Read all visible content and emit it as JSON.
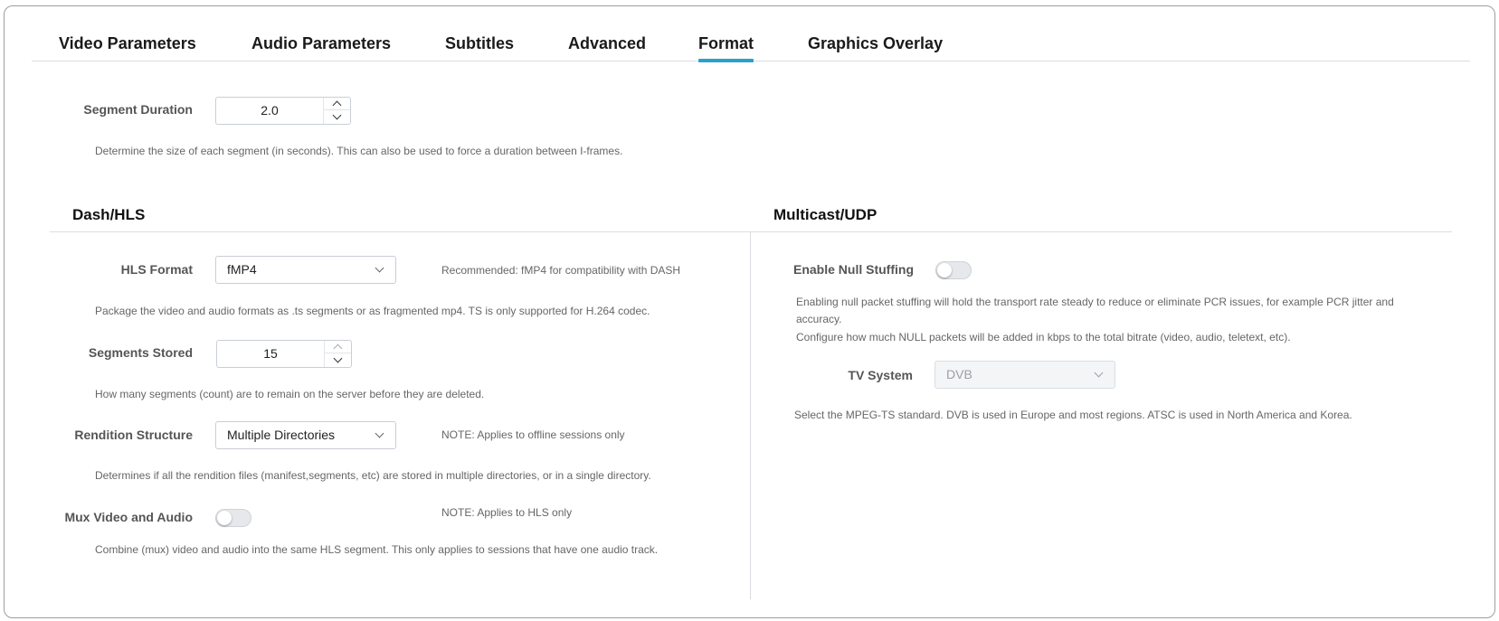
{
  "tabs": [
    {
      "label": "Video Parameters"
    },
    {
      "label": "Audio Parameters"
    },
    {
      "label": "Subtitles"
    },
    {
      "label": "Advanced"
    },
    {
      "label": "Format"
    },
    {
      "label": "Graphics Overlay"
    }
  ],
  "active_tab": "Format",
  "segment_duration": {
    "label": "Segment Duration",
    "value": "2.0",
    "help": "Determine the size of each segment (in seconds). This can also be used to force a duration between I-frames."
  },
  "dash_hls": {
    "title": "Dash/HLS",
    "hls_format": {
      "label": "HLS Format",
      "value": "fMP4",
      "note": "Recommended: fMP4 for compatibility with DASH",
      "help": "Package the video and audio formats as .ts segments or as fragmented mp4. TS is only supported for H.264 codec."
    },
    "segments_stored": {
      "label": "Segments Stored",
      "value": "15",
      "help": "How many segments (count) are to remain on the server before they are deleted."
    },
    "rendition_structure": {
      "label": "Rendition Structure",
      "value": "Multiple Directories",
      "note": "NOTE: Applies to offline sessions only",
      "help": "Determines if all the rendition files (manifest,segments, etc) are stored in multiple directories, or in a single directory."
    },
    "mux_video_audio": {
      "label": "Mux Video and Audio",
      "enabled": false,
      "note": "NOTE: Applies to HLS only",
      "help": "Combine (mux) video and audio into the same HLS segment. This only applies to sessions that have one audio track."
    }
  },
  "multicast": {
    "title": "Multicast/UDP",
    "null_stuffing": {
      "label": "Enable Null Stuffing",
      "enabled": false,
      "help_line1": "Enabling null packet stuffing will hold the transport rate steady to reduce or eliminate PCR issues, for example PCR jitter and",
      "help_line2": "accuracy.",
      "help_line3": "Configure how much NULL packets will be added in kbps to the total bitrate (video, audio, teletext, etc)."
    },
    "tv_system": {
      "label": "TV System",
      "value": "DVB",
      "help": "Select the MPEG-TS standard. DVB is used in Europe and most regions. ATSC is used in North America and Korea."
    }
  },
  "colors": {
    "accent": "#2a9fd0",
    "border": "#c9ced6",
    "muted_text": "#666666"
  }
}
